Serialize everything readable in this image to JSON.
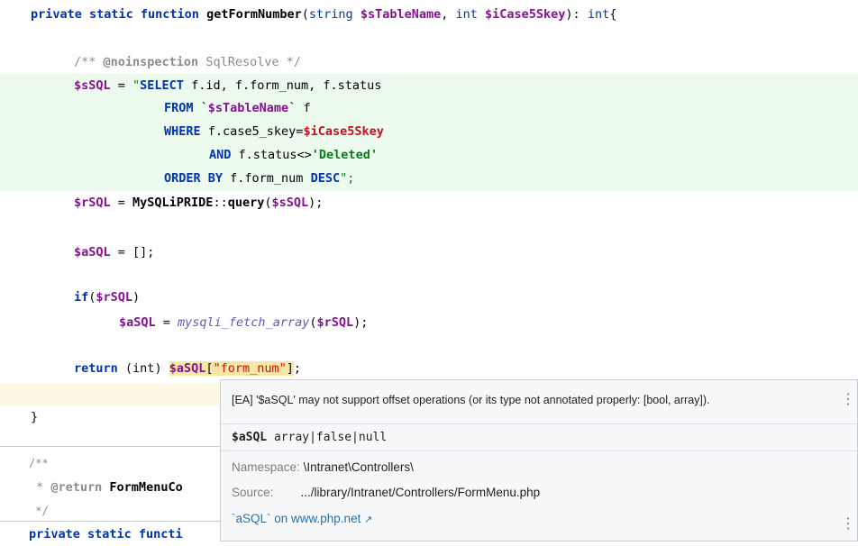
{
  "code": {
    "sig": {
      "mods": "private static function",
      "name": "getFormNumber",
      "open": "(",
      "t1": "string",
      "p1": "$sTableName",
      "comma": ", ",
      "t2": "int",
      "p2": "$iCase5Skey",
      "tail1": "): ",
      "ret": "int",
      "brace": "{"
    },
    "comment": {
      "open": "/** ",
      "tag": "@noinspection",
      "rest": " SqlResolve */"
    },
    "l_sql": {
      "var": "$sSQL",
      "eq": " = ",
      "q": "\"",
      "select": "SELECT",
      "cols": " f.id, f.form_num, f.status"
    },
    "l_from": {
      "from": "FROM",
      "rest": " `",
      "var": "$sTableName",
      "end": "` f"
    },
    "l_where": {
      "where": "WHERE",
      "rest": " f.case5_skey=",
      "var": "$iCase5Skey"
    },
    "l_and": {
      "and": "AND",
      "rest": " f.status<>",
      "str": "'Deleted'"
    },
    "l_order": {
      "order": "ORDER BY",
      "rest": " f.form_num ",
      "desc": "DESC",
      "end": "\";"
    },
    "l_query": {
      "var": "$rSQL",
      "eq": " = ",
      "cls": "MySQLiPRIDE",
      "sep": "::",
      "method": "query",
      "open": "(",
      "arg": "$sSQL",
      "close": ");"
    },
    "l_arr": {
      "var": "$aSQL",
      "rest": " = [];"
    },
    "l_if": {
      "kw": "if",
      "open": "(",
      "var": "$rSQL",
      "close": ")"
    },
    "l_fetch": {
      "var": "$aSQL",
      "eq": " = ",
      "fn": "mysqli_fetch_array",
      "open": "(",
      "arg": "$rSQL",
      "close": ");"
    },
    "l_return": {
      "kw": "return",
      "cast": " (",
      "type": "int",
      "castclose": ") ",
      "var": "$aSQL",
      "b1": "[",
      "key": "\"form_num\"",
      "b2": "]",
      "semi": ";"
    },
    "l_close": "}",
    "doc_open": "/**",
    "doc_return": {
      "star": " * ",
      "tag": "@return",
      "cls": " FormMenuCo"
    },
    "doc_close": " */",
    "next_sig": {
      "mods": "private static functi"
    }
  },
  "popup": {
    "warning": "[EA] '$aSQL' may not support offset operations (or its type not annotated properly: [bool, array]).",
    "type_var": "$aSQL",
    "type_value": " array|false|null",
    "ns_label": "Namespace:",
    "ns_value": "\\Intranet\\Controllers\\",
    "src_label": "Source:",
    "src_value": ".../library/Intranet/Controllers/FormMenu.php",
    "link": "`aSQL` on www.php.net",
    "link_arrow": "↗",
    "more": "⋮"
  }
}
